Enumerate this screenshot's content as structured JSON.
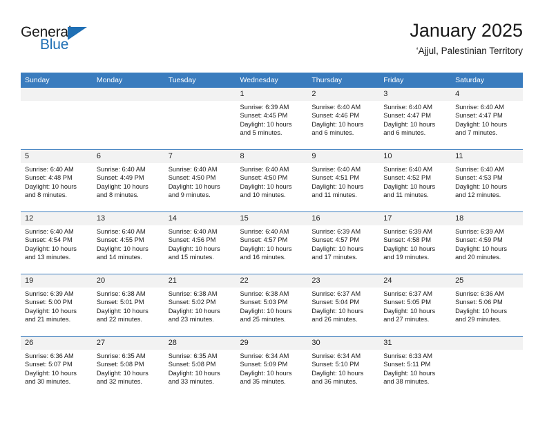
{
  "logo": {
    "word1": "General",
    "word2": "Blue",
    "accent_color": "#1f6fb4"
  },
  "header": {
    "title": "January 2025",
    "subtitle": "‘Ajjul, Palestinian Territory"
  },
  "calendar": {
    "header_bg": "#3a7cbe",
    "daynum_bg": "#f2f2f2",
    "weekday_headers": [
      "Sunday",
      "Monday",
      "Tuesday",
      "Wednesday",
      "Thursday",
      "Friday",
      "Saturday"
    ],
    "weeks": [
      [
        {
          "day": "",
          "sunrise": "",
          "sunset": "",
          "daylight": ""
        },
        {
          "day": "",
          "sunrise": "",
          "sunset": "",
          "daylight": ""
        },
        {
          "day": "",
          "sunrise": "",
          "sunset": "",
          "daylight": ""
        },
        {
          "day": "1",
          "sunrise": "Sunrise: 6:39 AM",
          "sunset": "Sunset: 4:45 PM",
          "daylight": "Daylight: 10 hours and 5 minutes."
        },
        {
          "day": "2",
          "sunrise": "Sunrise: 6:40 AM",
          "sunset": "Sunset: 4:46 PM",
          "daylight": "Daylight: 10 hours and 6 minutes."
        },
        {
          "day": "3",
          "sunrise": "Sunrise: 6:40 AM",
          "sunset": "Sunset: 4:47 PM",
          "daylight": "Daylight: 10 hours and 6 minutes."
        },
        {
          "day": "4",
          "sunrise": "Sunrise: 6:40 AM",
          "sunset": "Sunset: 4:47 PM",
          "daylight": "Daylight: 10 hours and 7 minutes."
        }
      ],
      [
        {
          "day": "5",
          "sunrise": "Sunrise: 6:40 AM",
          "sunset": "Sunset: 4:48 PM",
          "daylight": "Daylight: 10 hours and 8 minutes."
        },
        {
          "day": "6",
          "sunrise": "Sunrise: 6:40 AM",
          "sunset": "Sunset: 4:49 PM",
          "daylight": "Daylight: 10 hours and 8 minutes."
        },
        {
          "day": "7",
          "sunrise": "Sunrise: 6:40 AM",
          "sunset": "Sunset: 4:50 PM",
          "daylight": "Daylight: 10 hours and 9 minutes."
        },
        {
          "day": "8",
          "sunrise": "Sunrise: 6:40 AM",
          "sunset": "Sunset: 4:50 PM",
          "daylight": "Daylight: 10 hours and 10 minutes."
        },
        {
          "day": "9",
          "sunrise": "Sunrise: 6:40 AM",
          "sunset": "Sunset: 4:51 PM",
          "daylight": "Daylight: 10 hours and 11 minutes."
        },
        {
          "day": "10",
          "sunrise": "Sunrise: 6:40 AM",
          "sunset": "Sunset: 4:52 PM",
          "daylight": "Daylight: 10 hours and 11 minutes."
        },
        {
          "day": "11",
          "sunrise": "Sunrise: 6:40 AM",
          "sunset": "Sunset: 4:53 PM",
          "daylight": "Daylight: 10 hours and 12 minutes."
        }
      ],
      [
        {
          "day": "12",
          "sunrise": "Sunrise: 6:40 AM",
          "sunset": "Sunset: 4:54 PM",
          "daylight": "Daylight: 10 hours and 13 minutes."
        },
        {
          "day": "13",
          "sunrise": "Sunrise: 6:40 AM",
          "sunset": "Sunset: 4:55 PM",
          "daylight": "Daylight: 10 hours and 14 minutes."
        },
        {
          "day": "14",
          "sunrise": "Sunrise: 6:40 AM",
          "sunset": "Sunset: 4:56 PM",
          "daylight": "Daylight: 10 hours and 15 minutes."
        },
        {
          "day": "15",
          "sunrise": "Sunrise: 6:40 AM",
          "sunset": "Sunset: 4:57 PM",
          "daylight": "Daylight: 10 hours and 16 minutes."
        },
        {
          "day": "16",
          "sunrise": "Sunrise: 6:39 AM",
          "sunset": "Sunset: 4:57 PM",
          "daylight": "Daylight: 10 hours and 17 minutes."
        },
        {
          "day": "17",
          "sunrise": "Sunrise: 6:39 AM",
          "sunset": "Sunset: 4:58 PM",
          "daylight": "Daylight: 10 hours and 19 minutes."
        },
        {
          "day": "18",
          "sunrise": "Sunrise: 6:39 AM",
          "sunset": "Sunset: 4:59 PM",
          "daylight": "Daylight: 10 hours and 20 minutes."
        }
      ],
      [
        {
          "day": "19",
          "sunrise": "Sunrise: 6:39 AM",
          "sunset": "Sunset: 5:00 PM",
          "daylight": "Daylight: 10 hours and 21 minutes."
        },
        {
          "day": "20",
          "sunrise": "Sunrise: 6:38 AM",
          "sunset": "Sunset: 5:01 PM",
          "daylight": "Daylight: 10 hours and 22 minutes."
        },
        {
          "day": "21",
          "sunrise": "Sunrise: 6:38 AM",
          "sunset": "Sunset: 5:02 PM",
          "daylight": "Daylight: 10 hours and 23 minutes."
        },
        {
          "day": "22",
          "sunrise": "Sunrise: 6:38 AM",
          "sunset": "Sunset: 5:03 PM",
          "daylight": "Daylight: 10 hours and 25 minutes."
        },
        {
          "day": "23",
          "sunrise": "Sunrise: 6:37 AM",
          "sunset": "Sunset: 5:04 PM",
          "daylight": "Daylight: 10 hours and 26 minutes."
        },
        {
          "day": "24",
          "sunrise": "Sunrise: 6:37 AM",
          "sunset": "Sunset: 5:05 PM",
          "daylight": "Daylight: 10 hours and 27 minutes."
        },
        {
          "day": "25",
          "sunrise": "Sunrise: 6:36 AM",
          "sunset": "Sunset: 5:06 PM",
          "daylight": "Daylight: 10 hours and 29 minutes."
        }
      ],
      [
        {
          "day": "26",
          "sunrise": "Sunrise: 6:36 AM",
          "sunset": "Sunset: 5:07 PM",
          "daylight": "Daylight: 10 hours and 30 minutes."
        },
        {
          "day": "27",
          "sunrise": "Sunrise: 6:35 AM",
          "sunset": "Sunset: 5:08 PM",
          "daylight": "Daylight: 10 hours and 32 minutes."
        },
        {
          "day": "28",
          "sunrise": "Sunrise: 6:35 AM",
          "sunset": "Sunset: 5:08 PM",
          "daylight": "Daylight: 10 hours and 33 minutes."
        },
        {
          "day": "29",
          "sunrise": "Sunrise: 6:34 AM",
          "sunset": "Sunset: 5:09 PM",
          "daylight": "Daylight: 10 hours and 35 minutes."
        },
        {
          "day": "30",
          "sunrise": "Sunrise: 6:34 AM",
          "sunset": "Sunset: 5:10 PM",
          "daylight": "Daylight: 10 hours and 36 minutes."
        },
        {
          "day": "31",
          "sunrise": "Sunrise: 6:33 AM",
          "sunset": "Sunset: 5:11 PM",
          "daylight": "Daylight: 10 hours and 38 minutes."
        },
        {
          "day": "",
          "sunrise": "",
          "sunset": "",
          "daylight": ""
        }
      ]
    ]
  }
}
